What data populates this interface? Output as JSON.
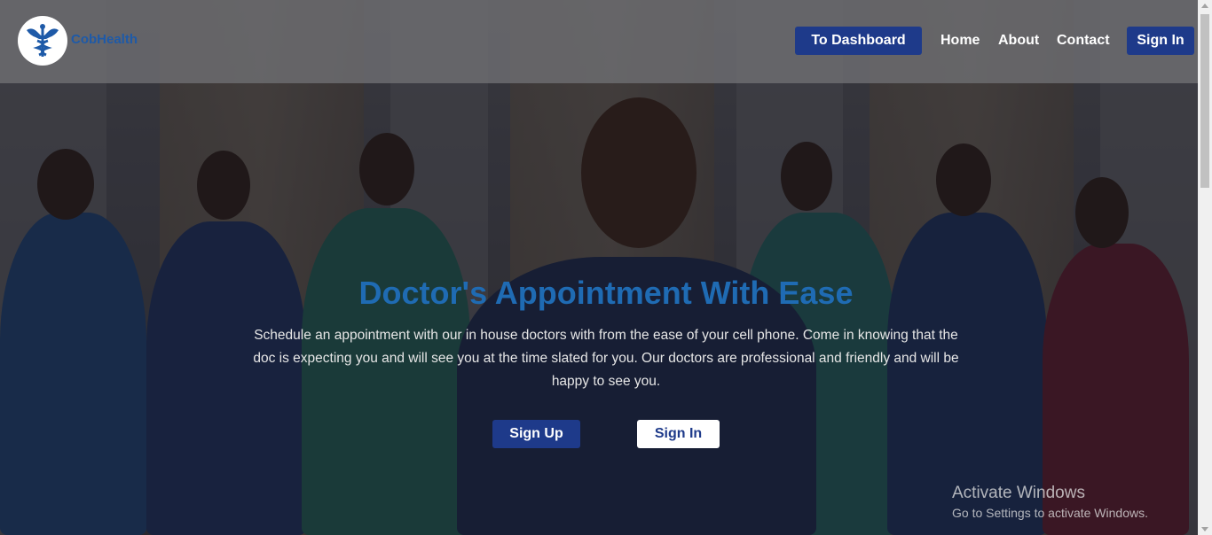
{
  "brand": {
    "name": "CobHealth",
    "logo": "caduceus-icon"
  },
  "nav": {
    "dashboard_label": "To Dashboard",
    "links": [
      "Home",
      "About",
      "Contact"
    ],
    "signin_label": "Sign In"
  },
  "hero": {
    "title": "Doctor's Appointment With Ease",
    "text": "Schedule an appointment with our in house doctors with from the ease of your cell phone. Come in knowing that the doc is expecting you and will see you at the time slated for you. Our doctors are professional and friendly and will be happy to see you.",
    "signup_label": "Sign Up",
    "signin_label": "Sign In"
  },
  "watermark": {
    "title": "Activate Windows",
    "subtitle": "Go to Settings to activate Windows."
  },
  "colors": {
    "accent": "#1e3a8a",
    "title_blue": "#1f6bb3",
    "brand_blue": "#1e5aa8"
  }
}
